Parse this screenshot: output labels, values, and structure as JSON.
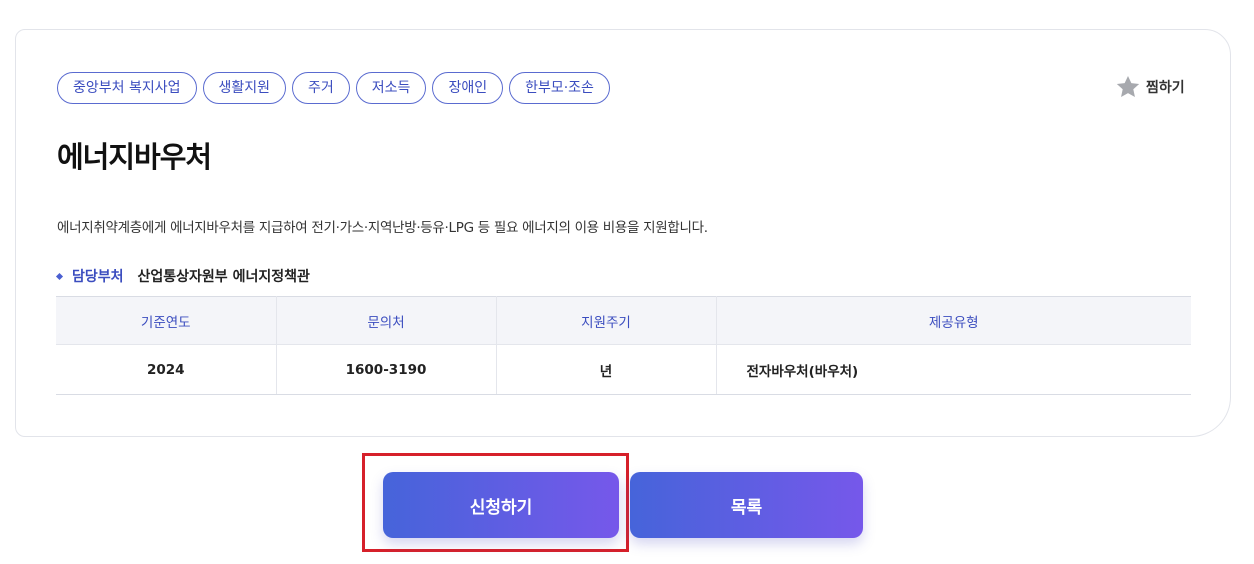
{
  "tags": [
    "중앙부처 복지사업",
    "생활지원",
    "주거",
    "저소득",
    "장애인",
    "한부모·조손"
  ],
  "favorite": {
    "label": "찜하기",
    "icon": "star-icon"
  },
  "title": "에너지바우처",
  "description": "에너지취약계층에게 에너지바우처를 지급하여 전기·가스·지역난방·등유·LPG 등 필요 에너지의 이용 비용을 지원합니다.",
  "department": {
    "label": "담당부처",
    "value": "산업통상자원부 에너지정책관"
  },
  "table": {
    "headers": [
      "기준연도",
      "문의처",
      "지원주기",
      "제공유형"
    ],
    "row": [
      "2024",
      "1600-3190",
      "년",
      "전자바우처(바우처)"
    ]
  },
  "buttons": {
    "apply": "신청하기",
    "list": "목록"
  },
  "colors": {
    "accent": "#3b4dbf",
    "gradient_start": "#4664da",
    "gradient_end": "#7658ea",
    "highlight": "#d6202a"
  }
}
